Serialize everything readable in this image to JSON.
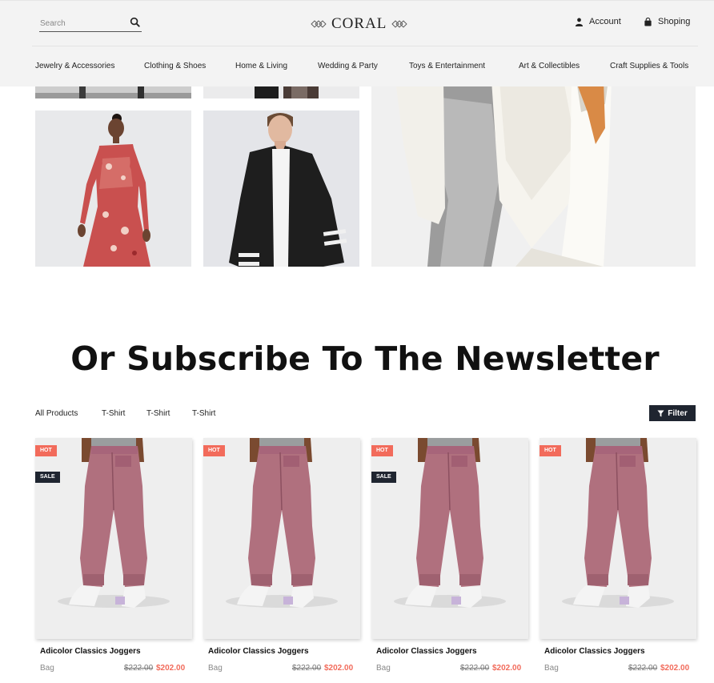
{
  "header": {
    "search": {
      "placeholder": "Search",
      "value": "",
      "icon": "search-icon"
    },
    "logo": {
      "text": "CORAL",
      "icon": "diamond-ornament-icon"
    },
    "account": {
      "label": "Account",
      "icon": "user-icon"
    },
    "shopping": {
      "label": "Shoping",
      "icon": "shopping-bag-icon"
    }
  },
  "nav": {
    "items": [
      "Jewelry & Accessories",
      "Clothing & Shoes",
      "Home & Living",
      "Wedding & Party",
      "Toys & Entertainment",
      "Art & Collectibles",
      "Craft Supplies & Tools"
    ]
  },
  "newsletter": {
    "title": "Or Subscribe To The Newsletter"
  },
  "tabs": {
    "items": [
      "All Products",
      "T-Shirt",
      "T-Shirt",
      "T-Shirt"
    ]
  },
  "filter": {
    "label": "Filter",
    "icon": "filter-funnel-icon"
  },
  "products": [
    {
      "name": "Adicolor Classics Joggers",
      "category": "Bag",
      "old_price": "$222.00",
      "price": "$202.00",
      "badge_hot": "HOT",
      "badge_sale": "SALE"
    },
    {
      "name": "Adicolor Classics Joggers",
      "category": "Bag",
      "old_price": "$222.00",
      "price": "$202.00",
      "badge_hot": "HOT",
      "badge_sale": ""
    },
    {
      "name": "Adicolor Classics Joggers",
      "category": "Bag",
      "old_price": "$222.00",
      "price": "$202.00",
      "badge_hot": "HOT",
      "badge_sale": "SALE"
    },
    {
      "name": "Adicolor Classics Joggers",
      "category": "Bag",
      "old_price": "$222.00",
      "price": "$202.00",
      "badge_hot": "HOT",
      "badge_sale": ""
    }
  ],
  "colors": {
    "accent": "#f26b5b",
    "dark": "#1f2530",
    "header_bg": "#f3f3f3"
  }
}
